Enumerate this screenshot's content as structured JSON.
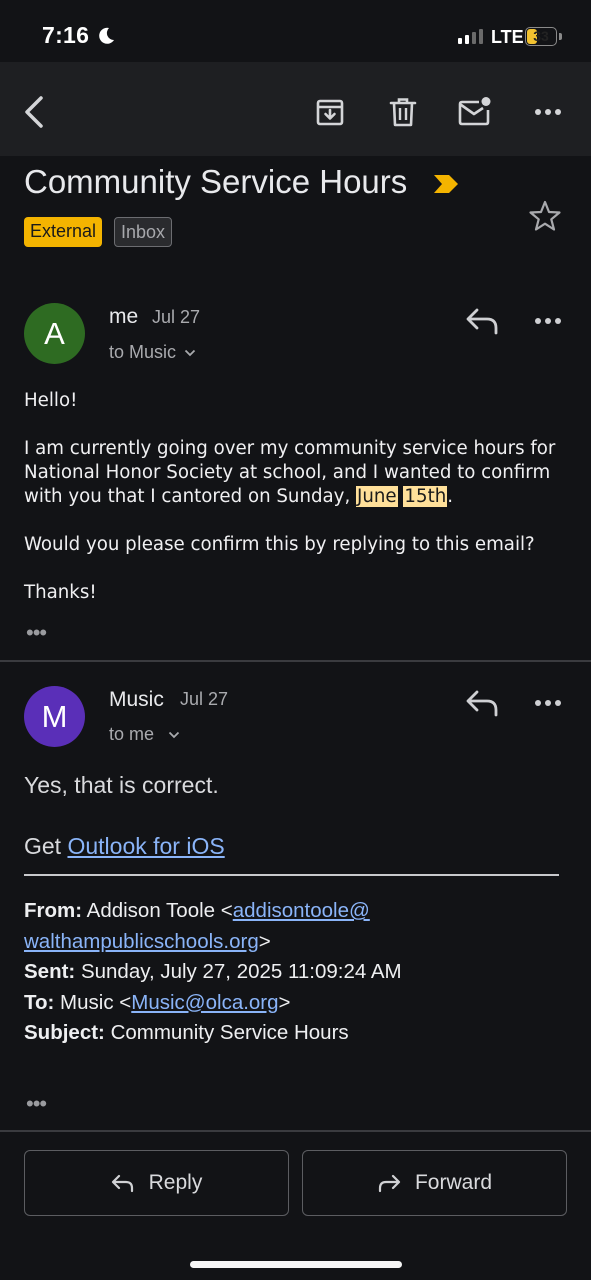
{
  "status_bar": {
    "time": "7:16",
    "network": "LTE",
    "battery": "33",
    "battery_level": 0.33
  },
  "toolbar": {
    "icons": [
      "back-icon",
      "archive-icon",
      "delete-icon",
      "mark-unread-icon",
      "more-icon"
    ]
  },
  "email": {
    "subject": "Community Service Hours",
    "labels": [
      "External",
      "Inbox"
    ]
  },
  "message1": {
    "avatar_letter": "A",
    "avatar_color": "#2e6b22",
    "sender": "me",
    "date": "Jul 27",
    "to": "to Music",
    "greeting": "Hello!",
    "para1_before": "I am currently going over my community service hours for National Honor Society at school, and I wanted to confirm with you that I cantored on Sunday, ",
    "para1_hl1": "June",
    "para1_hl2": "15th",
    "para1_after": ".",
    "para2": "Would you please confirm this by replying to this email?",
    "closing": "Thanks!",
    "more": "•••"
  },
  "message2": {
    "avatar_letter": "M",
    "avatar_color": "#5a2fb8",
    "sender": "Music",
    "date": "Jul 27",
    "to": "to me",
    "reply_text": "Yes, that is correct.",
    "get_prefix": "Get ",
    "get_link": "Outlook for iOS",
    "from_label": "From:",
    "from_name": " Addison Toole <",
    "from_email": "addisontoole@walthampublicschools.org",
    "from_email_part1": "addisontoole@",
    "from_email_part2": "walthampublicschools.org",
    "from_close": ">",
    "sent_label": "Sent:",
    "sent_value": " Sunday, July 27, 2025 11:09:24 AM",
    "to_label": "To:",
    "to_name": " Music <",
    "to_email": "Music@olca.org",
    "to_close": ">",
    "subject_label": "Subject:",
    "subject_value": " Community Service Hours",
    "more": "•••"
  },
  "actions": {
    "reply": "Reply",
    "forward": "Forward"
  }
}
